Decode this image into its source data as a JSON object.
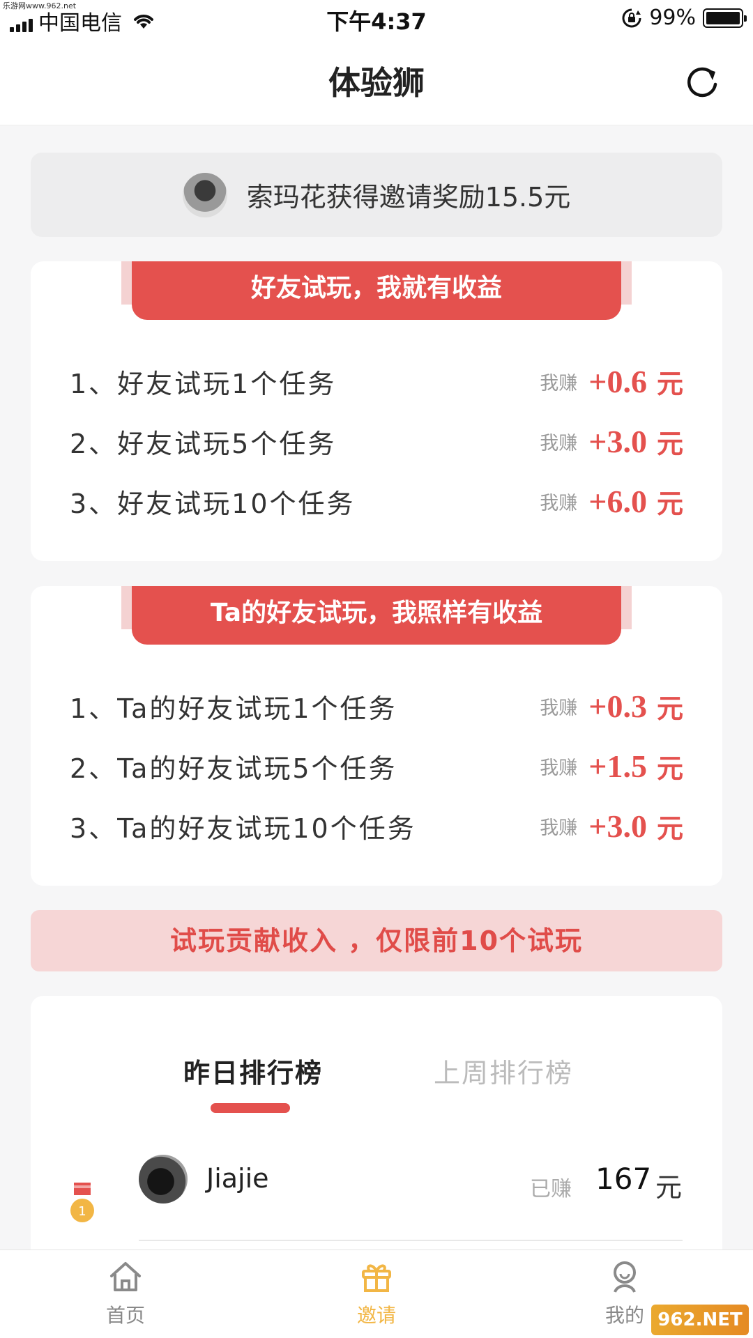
{
  "status_bar": {
    "site": "乐游网www.962.net",
    "carrier": "中国电信",
    "time": "下午4:37",
    "battery": "99%"
  },
  "nav": {
    "title": "体验狮",
    "refresh_icon": "refresh-icon"
  },
  "ticker": {
    "text": "索玛花获得邀请奖励15.5元"
  },
  "card1": {
    "tab": "好友试玩，我就有收益",
    "rows": [
      {
        "desc": "1、好友试玩1个任务",
        "label": "我赚",
        "amount": "+0.6",
        "unit": "元"
      },
      {
        "desc": "2、好友试玩5个任务",
        "label": "我赚",
        "amount": "+3.0",
        "unit": "元"
      },
      {
        "desc": "3、好友试玩10个任务",
        "label": "我赚",
        "amount": "+6.0",
        "unit": "元"
      }
    ]
  },
  "card2": {
    "tab": "Ta的好友试玩，我照样有收益",
    "rows": [
      {
        "desc": "1、Ta的好友试玩1个任务",
        "label": "我赚",
        "amount": "+0.3",
        "unit": "元"
      },
      {
        "desc": "2、Ta的好友试玩5个任务",
        "label": "我赚",
        "amount": "+1.5",
        "unit": "元"
      },
      {
        "desc": "3、Ta的好友试玩10个任务",
        "label": "我赚",
        "amount": "+3.0",
        "unit": "元"
      }
    ]
  },
  "notice": {
    "text": "试玩贡献收入 ，仅限前10个试玩"
  },
  "leaderboard": {
    "tabs": [
      "昨日排行榜",
      "上周排行榜"
    ],
    "rows": [
      {
        "rank": "1",
        "name": "Jiajie",
        "label": "已赚",
        "value": "167",
        "unit": "元"
      }
    ]
  },
  "tabbar": {
    "items": [
      {
        "label": "首页",
        "icon": "home-icon"
      },
      {
        "label": "邀请",
        "icon": "gift-icon"
      },
      {
        "label": "我的",
        "icon": "profile-icon"
      }
    ]
  },
  "watermark": "962.NET",
  "colors": {
    "accent": "#e4514e",
    "active_tab": "#f2b645",
    "notice_bg": "#f6d6d6"
  }
}
